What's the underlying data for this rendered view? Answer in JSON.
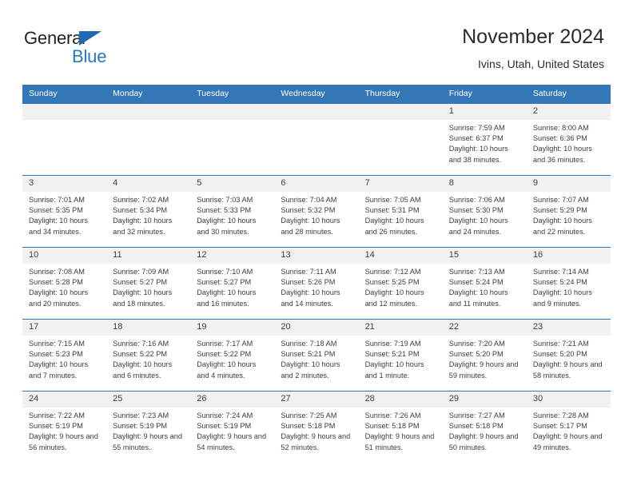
{
  "brand": {
    "name_part1": "General",
    "name_part2": "Blue",
    "triangle_color": "#1b6cb3",
    "blue_color": "#2579bf"
  },
  "header": {
    "title": "November 2024",
    "subtitle": "Ivins, Utah, United States"
  },
  "theme": {
    "header_blue": "#3477b7",
    "date_band": "#f1f1f1",
    "text": "#3c3c3c"
  },
  "weekdays": [
    "Sunday",
    "Monday",
    "Tuesday",
    "Wednesday",
    "Thursday",
    "Friday",
    "Saturday"
  ],
  "labels": {
    "sunrise": "Sunrise:",
    "sunset": "Sunset:",
    "daylight": "Daylight:"
  },
  "weeks": [
    [
      {
        "date": "",
        "empty": true
      },
      {
        "date": "",
        "empty": true
      },
      {
        "date": "",
        "empty": true
      },
      {
        "date": "",
        "empty": true
      },
      {
        "date": "",
        "empty": true
      },
      {
        "date": "1",
        "sunrise": "Sunrise: 7:59 AM",
        "sunset": "Sunset: 6:37 PM",
        "daylight": "Daylight: 10 hours and 38 minutes."
      },
      {
        "date": "2",
        "sunrise": "Sunrise: 8:00 AM",
        "sunset": "Sunset: 6:36 PM",
        "daylight": "Daylight: 10 hours and 36 minutes."
      }
    ],
    [
      {
        "date": "3",
        "sunrise": "Sunrise: 7:01 AM",
        "sunset": "Sunset: 5:35 PM",
        "daylight": "Daylight: 10 hours and 34 minutes."
      },
      {
        "date": "4",
        "sunrise": "Sunrise: 7:02 AM",
        "sunset": "Sunset: 5:34 PM",
        "daylight": "Daylight: 10 hours and 32 minutes."
      },
      {
        "date": "5",
        "sunrise": "Sunrise: 7:03 AM",
        "sunset": "Sunset: 5:33 PM",
        "daylight": "Daylight: 10 hours and 30 minutes."
      },
      {
        "date": "6",
        "sunrise": "Sunrise: 7:04 AM",
        "sunset": "Sunset: 5:32 PM",
        "daylight": "Daylight: 10 hours and 28 minutes."
      },
      {
        "date": "7",
        "sunrise": "Sunrise: 7:05 AM",
        "sunset": "Sunset: 5:31 PM",
        "daylight": "Daylight: 10 hours and 26 minutes."
      },
      {
        "date": "8",
        "sunrise": "Sunrise: 7:06 AM",
        "sunset": "Sunset: 5:30 PM",
        "daylight": "Daylight: 10 hours and 24 minutes."
      },
      {
        "date": "9",
        "sunrise": "Sunrise: 7:07 AM",
        "sunset": "Sunset: 5:29 PM",
        "daylight": "Daylight: 10 hours and 22 minutes."
      }
    ],
    [
      {
        "date": "10",
        "sunrise": "Sunrise: 7:08 AM",
        "sunset": "Sunset: 5:28 PM",
        "daylight": "Daylight: 10 hours and 20 minutes."
      },
      {
        "date": "11",
        "sunrise": "Sunrise: 7:09 AM",
        "sunset": "Sunset: 5:27 PM",
        "daylight": "Daylight: 10 hours and 18 minutes."
      },
      {
        "date": "12",
        "sunrise": "Sunrise: 7:10 AM",
        "sunset": "Sunset: 5:27 PM",
        "daylight": "Daylight: 10 hours and 16 minutes."
      },
      {
        "date": "13",
        "sunrise": "Sunrise: 7:11 AM",
        "sunset": "Sunset: 5:26 PM",
        "daylight": "Daylight: 10 hours and 14 minutes."
      },
      {
        "date": "14",
        "sunrise": "Sunrise: 7:12 AM",
        "sunset": "Sunset: 5:25 PM",
        "daylight": "Daylight: 10 hours and 12 minutes."
      },
      {
        "date": "15",
        "sunrise": "Sunrise: 7:13 AM",
        "sunset": "Sunset: 5:24 PM",
        "daylight": "Daylight: 10 hours and 11 minutes."
      },
      {
        "date": "16",
        "sunrise": "Sunrise: 7:14 AM",
        "sunset": "Sunset: 5:24 PM",
        "daylight": "Daylight: 10 hours and 9 minutes."
      }
    ],
    [
      {
        "date": "17",
        "sunrise": "Sunrise: 7:15 AM",
        "sunset": "Sunset: 5:23 PM",
        "daylight": "Daylight: 10 hours and 7 minutes."
      },
      {
        "date": "18",
        "sunrise": "Sunrise: 7:16 AM",
        "sunset": "Sunset: 5:22 PM",
        "daylight": "Daylight: 10 hours and 6 minutes."
      },
      {
        "date": "19",
        "sunrise": "Sunrise: 7:17 AM",
        "sunset": "Sunset: 5:22 PM",
        "daylight": "Daylight: 10 hours and 4 minutes."
      },
      {
        "date": "20",
        "sunrise": "Sunrise: 7:18 AM",
        "sunset": "Sunset: 5:21 PM",
        "daylight": "Daylight: 10 hours and 2 minutes."
      },
      {
        "date": "21",
        "sunrise": "Sunrise: 7:19 AM",
        "sunset": "Sunset: 5:21 PM",
        "daylight": "Daylight: 10 hours and 1 minute."
      },
      {
        "date": "22",
        "sunrise": "Sunrise: 7:20 AM",
        "sunset": "Sunset: 5:20 PM",
        "daylight": "Daylight: 9 hours and 59 minutes."
      },
      {
        "date": "23",
        "sunrise": "Sunrise: 7:21 AM",
        "sunset": "Sunset: 5:20 PM",
        "daylight": "Daylight: 9 hours and 58 minutes."
      }
    ],
    [
      {
        "date": "24",
        "sunrise": "Sunrise: 7:22 AM",
        "sunset": "Sunset: 5:19 PM",
        "daylight": "Daylight: 9 hours and 56 minutes."
      },
      {
        "date": "25",
        "sunrise": "Sunrise: 7:23 AM",
        "sunset": "Sunset: 5:19 PM",
        "daylight": "Daylight: 9 hours and 55 minutes."
      },
      {
        "date": "26",
        "sunrise": "Sunrise: 7:24 AM",
        "sunset": "Sunset: 5:19 PM",
        "daylight": "Daylight: 9 hours and 54 minutes."
      },
      {
        "date": "27",
        "sunrise": "Sunrise: 7:25 AM",
        "sunset": "Sunset: 5:18 PM",
        "daylight": "Daylight: 9 hours and 52 minutes."
      },
      {
        "date": "28",
        "sunrise": "Sunrise: 7:26 AM",
        "sunset": "Sunset: 5:18 PM",
        "daylight": "Daylight: 9 hours and 51 minutes."
      },
      {
        "date": "29",
        "sunrise": "Sunrise: 7:27 AM",
        "sunset": "Sunset: 5:18 PM",
        "daylight": "Daylight: 9 hours and 50 minutes."
      },
      {
        "date": "30",
        "sunrise": "Sunrise: 7:28 AM",
        "sunset": "Sunset: 5:17 PM",
        "daylight": "Daylight: 9 hours and 49 minutes."
      }
    ]
  ]
}
